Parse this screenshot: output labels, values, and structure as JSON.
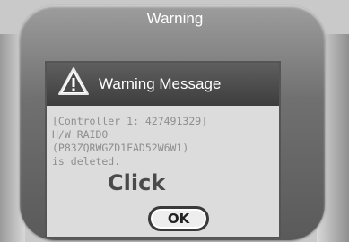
{
  "window": {
    "title": "Warning"
  },
  "dialog": {
    "title": "Warning Message",
    "icon": "warning-triangle-icon",
    "message_lines": [
      "[Controller 1: 427491329]",
      "H/W RAID0",
      "(P83ZQRWGZD1FAD52W6W1)",
      "is deleted."
    ],
    "ok_label": "OK"
  },
  "annotation": {
    "click_label": "Click"
  }
}
